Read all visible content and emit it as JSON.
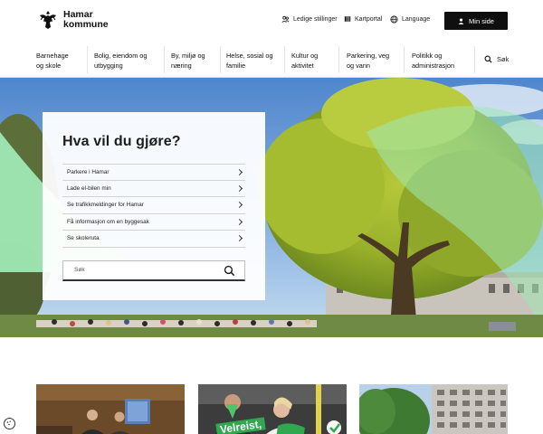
{
  "header": {
    "logo_line1": "Hamar",
    "logo_line2": "kommune",
    "links": [
      {
        "label": "Ledige stillinger",
        "icon": "people-icon"
      },
      {
        "label": "Kartportal",
        "icon": "map-icon"
      },
      {
        "label": "Language",
        "icon": "globe-icon"
      }
    ],
    "account_button": "Min side"
  },
  "nav": {
    "items": [
      {
        "line1": "Barnehage",
        "line2": "og skole"
      },
      {
        "line1": "Bolig, eiendom og",
        "line2": "utbygging"
      },
      {
        "line1": "By, miljø og",
        "line2": "næring"
      },
      {
        "line1": "Helse, sosial og",
        "line2": "familie"
      },
      {
        "line1": "Kultur og",
        "line2": "aktivitet"
      },
      {
        "line1": "Parkering, veg",
        "line2": "og vann"
      },
      {
        "line1": "Politikk og",
        "line2": "administrasjon"
      }
    ],
    "search_label": "Søk"
  },
  "hero": {
    "title": "Hva vil du gjøre?",
    "tasks": [
      "Parkere i Hamar",
      "Lade el-bilen min",
      "Se trafikkmeldinger for Hamar",
      "Få informasjon om en byggesak",
      "Se skoleruta"
    ],
    "search_placeholder": "Søk"
  },
  "cards": {
    "card2_sign_text": "Velreist,"
  },
  "colors": {
    "accent_green": "#9ee8b4",
    "button_dark": "#0f0f0f"
  }
}
